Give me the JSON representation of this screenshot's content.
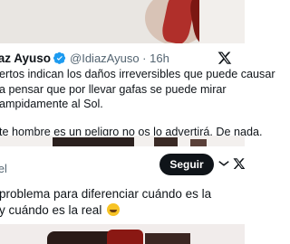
{
  "tweet1": {
    "name": "íaz Ayuso",
    "handle": "@IdiazAyuso · 16h",
    "lines": [
      "ertos indican los daños irreversibles que puede causar",
      "a pensar que por llevar gafas se puede mirar",
      "ampidamente al Sol."
    ],
    "last_line": "te hombre es un peligro no os lo advertirá. De nada."
  },
  "tweet2": {
    "partial_name": "el",
    "follow_label": "Seguir",
    "lines": [
      "problema para diferenciar cuándo es la",
      "y cuándo es la real"
    ]
  },
  "icons": {
    "verified": "verified-badge-icon",
    "x_logo": "x-logo-icon",
    "more": "more-options-icon",
    "emoji": "laughing-emoji-icon"
  },
  "colors": {
    "verified_blue": "#1d9bf0",
    "text": "#0f1419",
    "secondary": "#536471",
    "follow_bg": "#0f1419"
  }
}
